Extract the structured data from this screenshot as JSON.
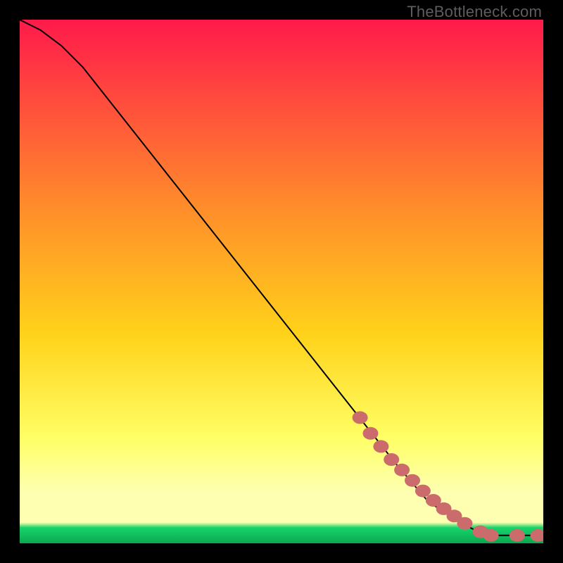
{
  "watermark": "TheBottleneck.com",
  "colors": {
    "gradient_top": "#ff1a4b",
    "gradient_mid_upper": "#ff8a2b",
    "gradient_mid": "#ffd21a",
    "gradient_mid_lower": "#ffff66",
    "gradient_lowband_top": "#feffb0",
    "gradient_green": "#17d46a",
    "gradient_bottom": "#0aa850",
    "line": "#000000",
    "marker_fill": "#cc6b6b",
    "marker_stroke": "#b45454"
  },
  "chart_data": {
    "type": "line",
    "title": "",
    "xlabel": "",
    "ylabel": "",
    "xlim": [
      0,
      100
    ],
    "ylim": [
      0,
      100
    ],
    "curve": [
      {
        "x": 0,
        "y": 100
      },
      {
        "x": 4,
        "y": 98
      },
      {
        "x": 8,
        "y": 95
      },
      {
        "x": 12,
        "y": 91
      },
      {
        "x": 72,
        "y": 15
      },
      {
        "x": 78,
        "y": 8
      },
      {
        "x": 84,
        "y": 4
      },
      {
        "x": 88,
        "y": 2
      },
      {
        "x": 90,
        "y": 1.5
      },
      {
        "x": 95,
        "y": 1.5
      },
      {
        "x": 100,
        "y": 1.5
      }
    ],
    "markers": [
      {
        "x": 65,
        "y": 24
      },
      {
        "x": 67,
        "y": 21
      },
      {
        "x": 69,
        "y": 18.5
      },
      {
        "x": 71,
        "y": 16
      },
      {
        "x": 73,
        "y": 14
      },
      {
        "x": 75,
        "y": 12
      },
      {
        "x": 77,
        "y": 10
      },
      {
        "x": 79,
        "y": 8.2
      },
      {
        "x": 81,
        "y": 6.6
      },
      {
        "x": 83,
        "y": 5.2
      },
      {
        "x": 85,
        "y": 3.8
      },
      {
        "x": 88,
        "y": 2.2
      },
      {
        "x": 90,
        "y": 1.5
      },
      {
        "x": 95,
        "y": 1.5
      },
      {
        "x": 99,
        "y": 1.5
      }
    ]
  }
}
